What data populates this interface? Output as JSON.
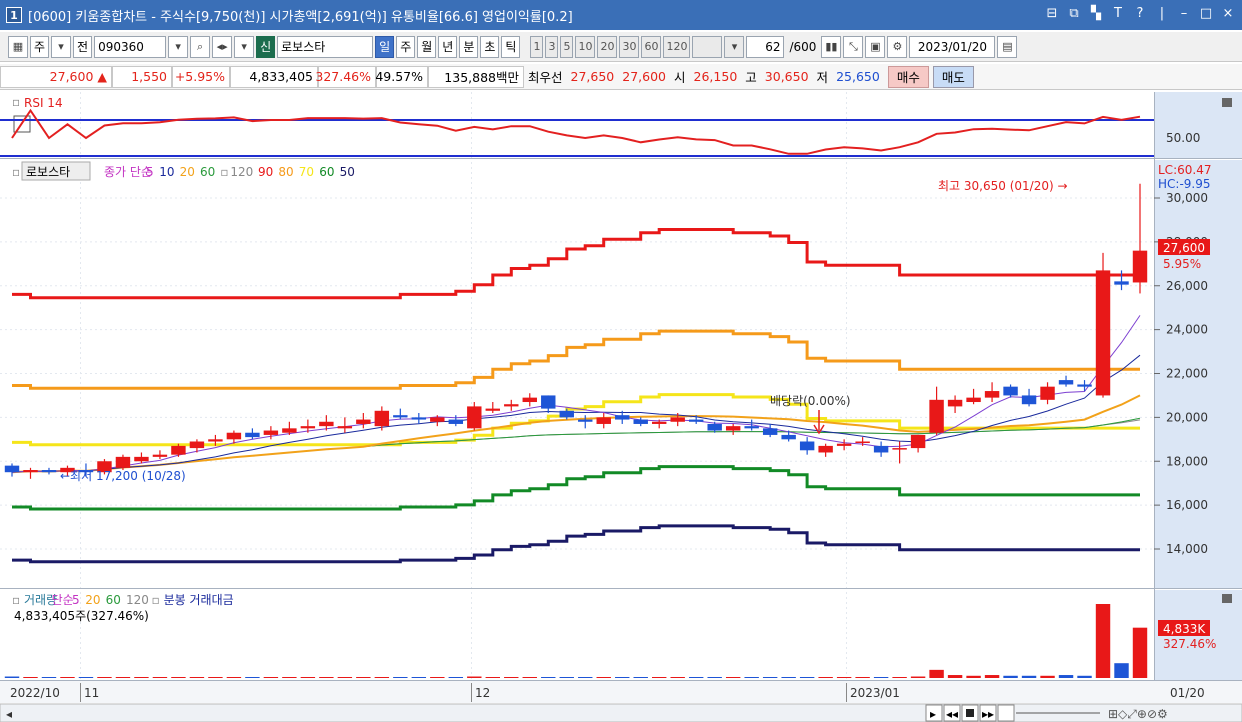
{
  "window": {
    "badge": "1",
    "title": "[0600] 키움종합차트 - 주식수[9,750(천)] 시가총액[2,691(억)] 유통비율[66.6] 영업이익률[0.2]",
    "buttons": [
      "⊟",
      "⧉",
      "▚",
      "T",
      "?",
      "|",
      "–",
      "□",
      "×"
    ]
  },
  "toolbar": {
    "period_select": "주",
    "prev_label": "전",
    "stock_code": "090360",
    "credit_label": "신",
    "stock_name": "로보스타",
    "period_tabs": [
      "일",
      "주",
      "월",
      "년",
      "분",
      "초",
      "틱"
    ],
    "intervals": [
      "1",
      "3",
      "5",
      "10",
      "20",
      "30",
      "60",
      "120"
    ],
    "count_value": "62",
    "count_total": "/600",
    "date_value": "2023/01/20"
  },
  "quote": {
    "price": "27,600 ▲",
    "change": "1,550",
    "change_pct": "+5.95%",
    "volume": "4,833,405",
    "volume_ratio": "327.46%",
    "turnover": "49.57%",
    "amount": "135,888백만",
    "best_label": "최우선",
    "best_ask": "27,650",
    "best_bid": "27,600",
    "open_label": "시",
    "open": "26,150",
    "high_label": "고",
    "high": "30,650",
    "low_label": "저",
    "low": "25,650",
    "buy_label": "매수",
    "sell_label": "매도"
  },
  "colors": {
    "up": "#e3241b",
    "down": "#1f4fd0",
    "ma5": "#7c3fd1",
    "ma10": "#1a2a9c",
    "ma20": "#f2a21a",
    "ma60": "#2a9a3c",
    "ma120": "#888888",
    "env90": "#e81818",
    "env80": "#f59a1a",
    "env70": "#f5e51a",
    "env60": "#128a26",
    "env50": "#1a1a66",
    "rsi": "#e32020",
    "panel_bg": "#dbe6f5"
  },
  "rsi_panel": {
    "title": "RSI 14",
    "axis_label": "50.00"
  },
  "price_panel": {
    "name_tag": "로보스타",
    "legend": [
      {
        "text": "종가 단순",
        "color": "#c334c3"
      },
      {
        "text": "5",
        "color": "#c334c3"
      },
      {
        "text": "10",
        "color": "#1a2a9c"
      },
      {
        "text": "20",
        "color": "#f2a21a"
      },
      {
        "text": "60",
        "color": "#2a9a3c"
      },
      {
        "text": "120",
        "color": "#888888"
      },
      {
        "text": "90",
        "color": "#e81818"
      },
      {
        "text": "80",
        "color": "#f59a1a"
      },
      {
        "text": "70",
        "color": "#f5e51a"
      },
      {
        "text": "60",
        "color": "#128a26"
      },
      {
        "text": "50",
        "color": "#1a1a66"
      }
    ],
    "lc": "LC:60.47",
    "hc": "HC:-9.95",
    "high_annotation": "최고 30,650 (01/20) →",
    "low_annotation": "←최저 17,200 (10/28)",
    "dividend_annotation": "배당락(0.00%)",
    "current_price": "27,600",
    "current_pct": "5.95%",
    "y_ticks": [
      "30,000",
      "28,000",
      "26,000",
      "24,000",
      "22,000",
      "20,000",
      "18,000",
      "16,000",
      "14,000"
    ]
  },
  "volume_panel": {
    "legend": [
      {
        "text": "거래량",
        "color": "#2a7a9a"
      },
      {
        "text": "단순",
        "color": "#c334c3"
      },
      {
        "text": "5",
        "color": "#c334c3"
      },
      {
        "text": "20",
        "color": "#f2a21a"
      },
      {
        "text": "60",
        "color": "#2a9a3c"
      },
      {
        "text": "120",
        "color": "#888888"
      },
      {
        "text": "분봉 거래대금",
        "color": "#1a2a9c"
      }
    ],
    "info": "4,833,405주(327.46%)",
    "current_value": "4,833K",
    "current_pct": "327.46%"
  },
  "x_axis": {
    "labels": [
      "2022/10",
      "11",
      "12",
      "2023/01"
    ],
    "right_label": "01/20"
  },
  "chart_data": {
    "type": "candlestick",
    "ylim": [
      13000,
      31000
    ],
    "candles": [
      [
        17800,
        17900,
        17300,
        17500
      ],
      [
        17500,
        17700,
        17200,
        17600
      ],
      [
        17600,
        17700,
        17400,
        17500
      ],
      [
        17500,
        17800,
        17300,
        17700
      ],
      [
        17600,
        17900,
        17300,
        17500
      ],
      [
        17500,
        18100,
        17400,
        18000
      ],
      [
        17700,
        18300,
        17600,
        18200
      ],
      [
        18000,
        18400,
        17900,
        18200
      ],
      [
        18200,
        18500,
        18100,
        18300
      ],
      [
        18300,
        18800,
        18200,
        18700
      ],
      [
        18600,
        19000,
        18400,
        18900
      ],
      [
        18900,
        19200,
        18700,
        19000
      ],
      [
        19000,
        19400,
        18800,
        19300
      ],
      [
        19300,
        19500,
        19000,
        19100
      ],
      [
        19200,
        19600,
        19000,
        19400
      ],
      [
        19300,
        19800,
        19200,
        19500
      ],
      [
        19500,
        19900,
        19300,
        19600
      ],
      [
        19600,
        20100,
        19400,
        19800
      ],
      [
        19500,
        20000,
        19300,
        19600
      ],
      [
        19700,
        20200,
        19500,
        19900
      ],
      [
        19600,
        20500,
        19400,
        20300
      ],
      [
        20100,
        20400,
        19900,
        20000
      ],
      [
        20000,
        20200,
        19700,
        19900
      ],
      [
        19800,
        20100,
        19600,
        20000
      ],
      [
        19900,
        20100,
        19600,
        19700
      ],
      [
        19500,
        20700,
        19400,
        20500
      ],
      [
        20300,
        20700,
        20200,
        20400
      ],
      [
        20500,
        20800,
        20300,
        20600
      ],
      [
        20700,
        21100,
        20500,
        20900
      ],
      [
        21000,
        21000,
        20200,
        20400
      ],
      [
        20300,
        20400,
        19900,
        20000
      ],
      [
        19900,
        20100,
        19500,
        19800
      ],
      [
        19700,
        20200,
        19500,
        20000
      ],
      [
        20100,
        20300,
        19700,
        19900
      ],
      [
        19900,
        20000,
        19600,
        19700
      ],
      [
        19700,
        19900,
        19500,
        19800
      ],
      [
        19800,
        20200,
        19600,
        20000
      ],
      [
        19900,
        20100,
        19700,
        19800
      ],
      [
        19700,
        19800,
        19300,
        19400
      ],
      [
        19400,
        19700,
        19200,
        19600
      ],
      [
        19600,
        19900,
        19400,
        19500
      ],
      [
        19500,
        19700,
        19100,
        19200
      ],
      [
        19200,
        19400,
        18900,
        19000
      ],
      [
        18900,
        19100,
        18300,
        18500
      ],
      [
        18400,
        18800,
        18200,
        18700
      ],
      [
        18700,
        19000,
        18500,
        18800
      ],
      [
        18900,
        19100,
        18700,
        18900
      ],
      [
        18700,
        18900,
        18200,
        18400
      ],
      [
        18600,
        18900,
        17900,
        18600
      ],
      [
        18600,
        19200,
        18400,
        19200
      ],
      [
        19300,
        21400,
        19200,
        20800
      ],
      [
        20500,
        21000,
        20200,
        20800
      ],
      [
        20700,
        21300,
        20600,
        20900
      ],
      [
        20900,
        21600,
        20700,
        21200
      ],
      [
        21400,
        21500,
        20900,
        21000
      ],
      [
        21000,
        21300,
        20500,
        20600
      ],
      [
        20800,
        21600,
        20600,
        21400
      ],
      [
        21700,
        21900,
        21400,
        21500
      ],
      [
        21500,
        21700,
        21200,
        21400
      ],
      [
        21000,
        27500,
        20900,
        26700
      ],
      [
        26200,
        26700,
        25800,
        26050
      ],
      [
        26150,
        30650,
        25650,
        27600
      ]
    ],
    "volume_pct": [
      2,
      1,
      1,
      1,
      1,
      1,
      1,
      1,
      1,
      1,
      1,
      1,
      1,
      1,
      1,
      1,
      1,
      1,
      1,
      1,
      1,
      1,
      1,
      1,
      1,
      2,
      1,
      1,
      1,
      1,
      1,
      1,
      1,
      1,
      1,
      1,
      1,
      1,
      1,
      1,
      1,
      1,
      1,
      1,
      1,
      1,
      1,
      1,
      1,
      2,
      11,
      4,
      3,
      4,
      3,
      3,
      3,
      4,
      3,
      100,
      20,
      68
    ]
  }
}
